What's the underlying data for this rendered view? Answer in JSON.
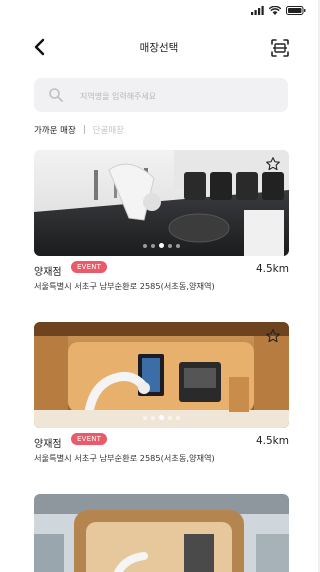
{
  "header": {
    "title": "매장선택"
  },
  "search": {
    "placeholder": "지역명을 입력해주세요"
  },
  "filters": {
    "active": "가까운 매장",
    "separator": "|",
    "inactive": "단골매장"
  },
  "stores": [
    {
      "name": "양재점",
      "badge": "EVENT",
      "distance": "4.5km",
      "address": "서울특별시 서초구 남부순환로 2585(서초동,양재역)"
    },
    {
      "name": "양재점",
      "badge": "EVENT",
      "distance": "4.5km",
      "address": "서울특별시 서초구 남부순환로 2585(서초동,양재역)"
    },
    {
      "name": "",
      "badge": "",
      "distance": "",
      "address": ""
    }
  ],
  "carousel": {
    "count": 5,
    "active_index": 2
  },
  "colors": {
    "badge": "#e95a6a",
    "search_bg": "#f1f1f3",
    "inactive_filter": "#c3c3c7"
  },
  "icons": {
    "back": "chevron-left-icon",
    "scan": "scan-icon",
    "search": "search-icon",
    "favorite": "star-outline-icon",
    "signal": "signal-icon",
    "wifi": "wifi-icon",
    "battery": "battery-icon"
  }
}
